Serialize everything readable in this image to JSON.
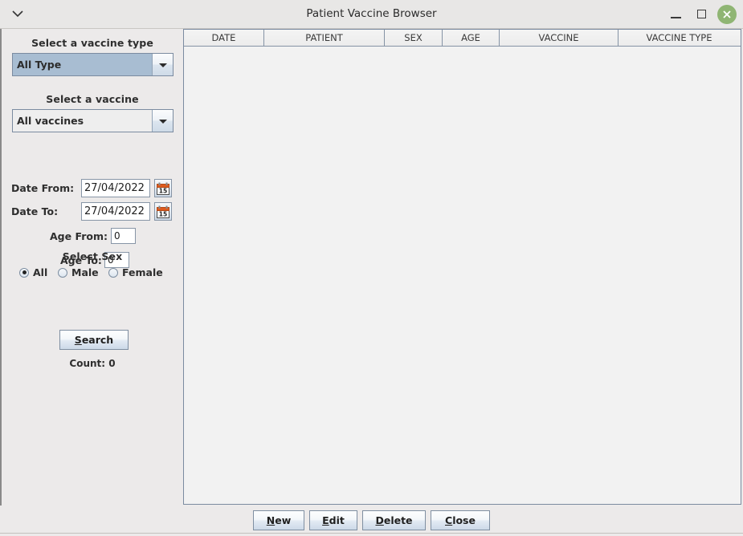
{
  "window": {
    "title": "Patient Vaccine Browser",
    "menu_icon": "chevron-down-icon",
    "minimize_label": "Minimize",
    "maximize_label": "Maximize",
    "close_label": "Close",
    "close_button_color": "#8fb573"
  },
  "sidebar": {
    "vaccine_type_heading": "Select a vaccine type",
    "vaccine_type_value": "All Type",
    "vaccine_heading": "Select a vaccine",
    "vaccine_value": "All vaccines",
    "date_from_label": "Date From:",
    "date_from_value": "27/04/2022",
    "date_to_label": "Date To:",
    "date_to_value": "27/04/2022",
    "age_from_label": "Age From:",
    "age_from_value": "0",
    "age_to_label": "Age To:",
    "age_to_value": "0",
    "sex_heading": "Select Sex",
    "sex_options": [
      {
        "label": "All",
        "checked": true
      },
      {
        "label": "Male",
        "checked": false
      },
      {
        "label": "Female",
        "checked": false
      }
    ],
    "search_mnemonic": "S",
    "search_rest": "earch",
    "count_label": "Count: 0",
    "calendar_icon": "calendar-icon",
    "calendar_day": "15"
  },
  "table": {
    "columns": [
      {
        "label": "DATE",
        "width": 100
      },
      {
        "label": "PATIENT",
        "width": 150
      },
      {
        "label": "SEX",
        "width": 72
      },
      {
        "label": "AGE",
        "width": 71
      },
      {
        "label": "VACCINE",
        "width": 148
      },
      {
        "label": "VACCINE TYPE",
        "width": 151
      }
    ],
    "rows": []
  },
  "footer": {
    "buttons": [
      {
        "mnemonic": "N",
        "rest": "ew",
        "name": "new"
      },
      {
        "mnemonic": "E",
        "rest": "dit",
        "name": "edit"
      },
      {
        "mnemonic": "D",
        "rest": "elete",
        "name": "delete"
      },
      {
        "mnemonic": "C",
        "rest": "lose",
        "name": "close"
      }
    ]
  }
}
